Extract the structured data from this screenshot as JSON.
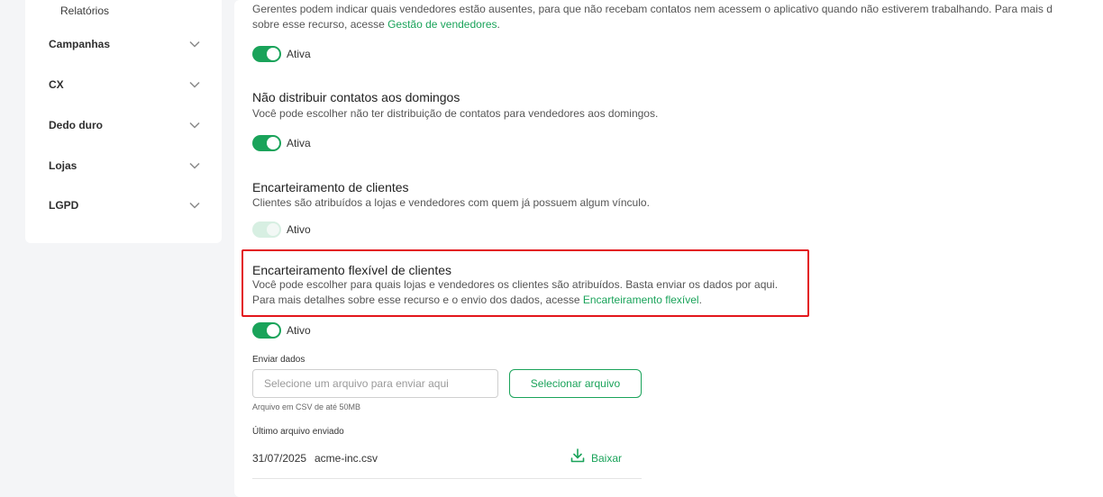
{
  "sidebar": {
    "sub_item": "Relatórios",
    "items": [
      {
        "label": "Campanhas"
      },
      {
        "label": "CX"
      },
      {
        "label": "Dedo duro"
      },
      {
        "label": "Lojas"
      },
      {
        "label": "LGPD"
      }
    ]
  },
  "sections": {
    "absent": {
      "desc_line1": "Gerentes podem indicar quais vendedores estão ausentes, para que não recebam contatos nem acessem o aplicativo quando não estiverem trabalhando. Para mais d",
      "desc_line2_prefix": "sobre esse recurso, acesse ",
      "desc_link": "Gestão de vendedores",
      "desc_line2_suffix": ".",
      "toggle_label": "Ativa"
    },
    "sundays": {
      "title": "Não distribuir contatos aos domingos",
      "desc": "Você pode escolher não ter distribuição de contatos para vendedores aos domingos.",
      "toggle_label": "Ativa"
    },
    "encarteiramento": {
      "title": "Encarteiramento de clientes",
      "desc": "Clientes são atribuídos a lojas e vendedores com quem já possuem algum vínculo.",
      "toggle_label": "Ativo"
    },
    "flexivel": {
      "title": "Encarteiramento flexível de clientes",
      "desc_line1": "Você pode escolher para quais lojas e vendedores os clientes são atribuídos. Basta enviar os dados por aqui.",
      "desc_line2_prefix": "Para mais detalhes sobre esse recurso e o envio dos dados, acesse ",
      "desc_link": "Encarteiramento flexível",
      "desc_line2_suffix": ".",
      "toggle_label": "Ativo"
    }
  },
  "upload": {
    "label": "Enviar dados",
    "placeholder": "Selecione um arquivo para enviar aqui",
    "button": "Selecionar arquivo",
    "hint": "Arquivo em CSV de até 50MB",
    "last_label": "Último arquivo enviado",
    "last_date": "31/07/2025",
    "last_file": "acme-inc.csv",
    "download": "Baixar"
  },
  "colors": {
    "accent": "#1aa35a",
    "highlight": "#e3161b"
  }
}
